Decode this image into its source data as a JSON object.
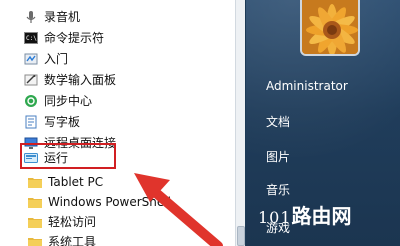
{
  "left_menu": {
    "items": [
      {
        "label": "录音机",
        "icon": "microphone-icon"
      },
      {
        "label": "命令提示符",
        "icon": "cmd-icon"
      },
      {
        "label": "入门",
        "icon": "getting-started-icon"
      },
      {
        "label": "数学输入面板",
        "icon": "math-input-icon"
      },
      {
        "label": "同步中心",
        "icon": "sync-center-icon"
      },
      {
        "label": "写字板",
        "icon": "wordpad-icon"
      },
      {
        "label": "远程桌面连接",
        "icon": "remote-desktop-icon"
      },
      {
        "label": "运行",
        "icon": "run-icon"
      }
    ],
    "folders": [
      {
        "label": "Tablet PC",
        "icon": "folder-icon"
      },
      {
        "label": "Windows PowerShell",
        "icon": "folder-icon"
      },
      {
        "label": "轻松访问",
        "icon": "folder-icon"
      },
      {
        "label": "系统工具",
        "icon": "folder-icon"
      }
    ]
  },
  "right_menu": {
    "user": "Administrator",
    "documents": "文档",
    "pictures": "图片",
    "music": "音乐",
    "games": "游戏"
  },
  "watermark": {
    "number": "101",
    "text": "路由网"
  },
  "colors": {
    "highlight": "#d11f22",
    "arrow": "#e0342c",
    "right_panel": "#203d5b"
  }
}
